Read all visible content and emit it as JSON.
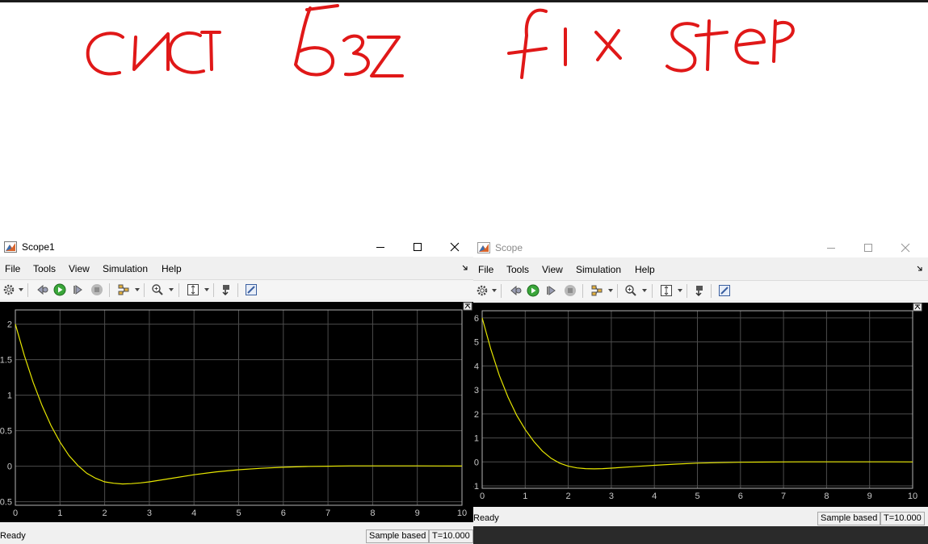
{
  "handwritten_note": "сист без fix step",
  "colors": {
    "signal": "#e6e600",
    "grid": "#4d4d4d",
    "axes": "#b3b3b3",
    "plot_bg": "#000000",
    "ink": "#e01818"
  },
  "menu": [
    "File",
    "Tools",
    "View",
    "Simulation",
    "Help"
  ],
  "windows": [
    {
      "title": "Scope1",
      "status": {
        "ready": "Ready",
        "mode": "Sample based",
        "time": "T=10.000"
      },
      "chart_data": {
        "type": "line",
        "xlim": [
          0,
          10
        ],
        "ylim": [
          -0.55,
          2.2
        ],
        "xticks": [
          "0",
          "1",
          "2",
          "3",
          "4",
          "5",
          "6",
          "7",
          "8",
          "9",
          "10"
        ],
        "yticks": [
          {
            "v": 2,
            "label": "2"
          },
          {
            "v": 1.5,
            "label": "1.5"
          },
          {
            "v": 1,
            "label": "1"
          },
          {
            "v": 0.5,
            "label": "0.5"
          },
          {
            "v": 0,
            "label": "0"
          },
          {
            "v": -0.5,
            "label": "-0.5"
          }
        ],
        "grid": true,
        "series": [
          {
            "x": [
              0,
              0.2,
              0.4,
              0.6,
              0.8,
              1,
              1.2,
              1.4,
              1.6,
              1.8,
              2,
              2.2,
              2.4,
              2.6,
              2.8,
              3,
              3.5,
              4,
              4.5,
              5,
              5.5,
              6,
              6.5,
              7,
              7.5,
              8,
              8.5,
              9,
              9.5,
              10
            ],
            "y": [
              2,
              1.56,
              1.18,
              0.85,
              0.57,
              0.34,
              0.15,
              0.01,
              -0.1,
              -0.17,
              -0.22,
              -0.24,
              -0.25,
              -0.245,
              -0.235,
              -0.22,
              -0.17,
              -0.12,
              -0.08,
              -0.05,
              -0.03,
              -0.015,
              -0.005,
              0,
              0.004,
              0.005,
              0.005,
              0.004,
              0.003,
              0.002
            ]
          }
        ]
      }
    },
    {
      "title": "Scope",
      "status": {
        "ready": "Ready",
        "mode": "Sample based",
        "time": "T=10.000"
      },
      "chart_data": {
        "type": "line",
        "xlim": [
          0,
          10
        ],
        "ylim": [
          -1.1,
          6.3
        ],
        "xticks": [
          "0",
          "1",
          "2",
          "3",
          "4",
          "5",
          "6",
          "7",
          "8",
          "9",
          "10"
        ],
        "yticks": [
          {
            "v": 6,
            "label": "6"
          },
          {
            "v": 5,
            "label": "5"
          },
          {
            "v": 4,
            "label": "4"
          },
          {
            "v": 3,
            "label": "3"
          },
          {
            "v": 2,
            "label": "2"
          },
          {
            "v": 1,
            "label": "1"
          },
          {
            "v": 0,
            "label": "0"
          },
          {
            "v": -1,
            "label": "-1"
          }
        ],
        "grid": true,
        "series": [
          {
            "x": [
              0,
              0.2,
              0.4,
              0.6,
              0.8,
              1,
              1.2,
              1.4,
              1.6,
              1.8,
              2,
              2.2,
              2.4,
              2.6,
              2.8,
              3,
              3.5,
              4,
              4.5,
              5,
              5.5,
              6,
              6.5,
              7,
              7.5,
              8,
              8.5,
              9,
              9.5,
              10
            ],
            "y": [
              6,
              4.7,
              3.6,
              2.7,
              1.95,
              1.35,
              0.85,
              0.45,
              0.15,
              -0.05,
              -0.18,
              -0.25,
              -0.28,
              -0.29,
              -0.28,
              -0.26,
              -0.2,
              -0.14,
              -0.09,
              -0.05,
              -0.03,
              -0.015,
              -0.006,
              0,
              0.003,
              0.004,
              0.004,
              0.003,
              0.002,
              0.001
            ]
          }
        ]
      }
    }
  ]
}
